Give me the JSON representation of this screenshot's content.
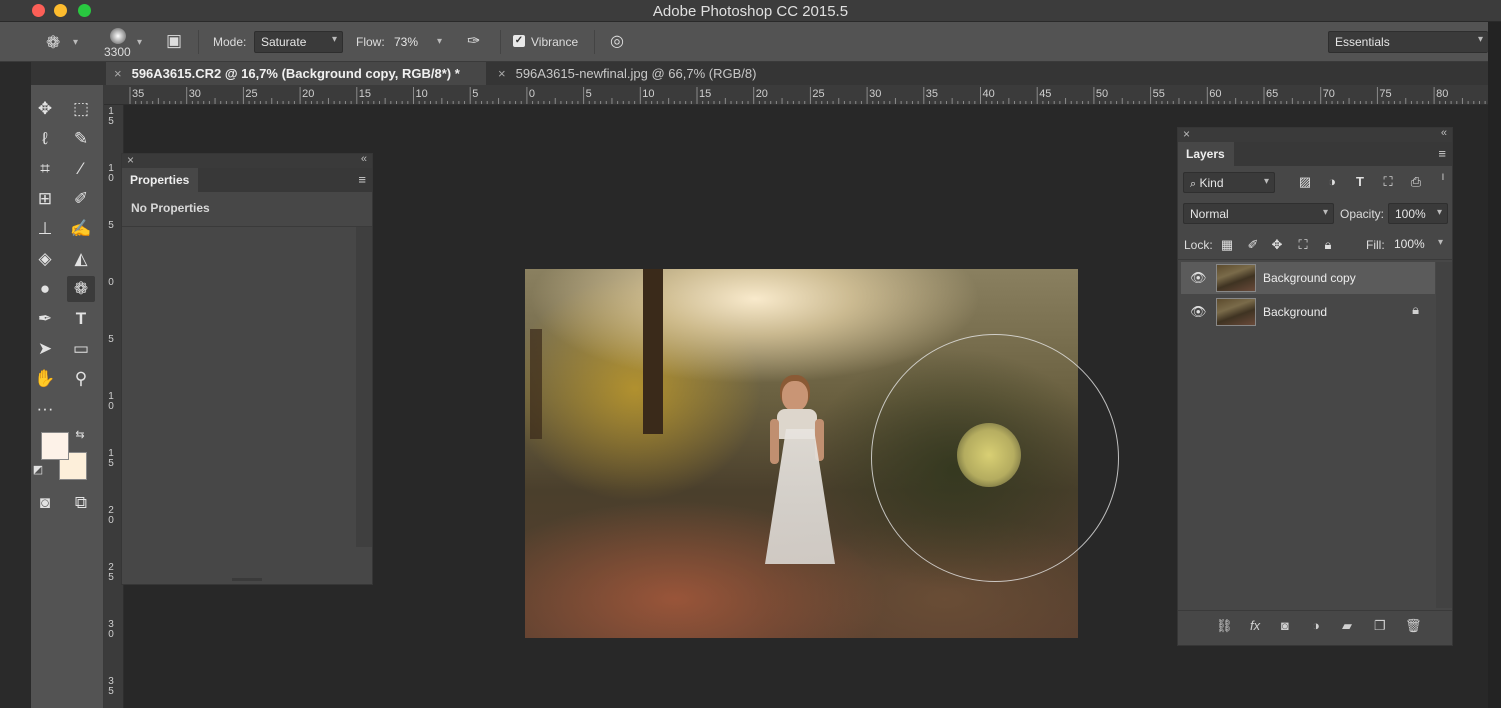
{
  "window": {
    "title": "Adobe Photoshop CC 2015.5"
  },
  "options_bar": {
    "brush_size": "3300",
    "mode_label": "Mode:",
    "mode_value": "Saturate",
    "flow_label": "Flow:",
    "flow_value": "73%",
    "vibrance_label": "Vibrance",
    "vibrance_checked": true,
    "workspace": "Essentials"
  },
  "tabs": [
    {
      "label": "596A3615.CR2 @ 16,7% (Background copy, RGB/8*) *",
      "active": true
    },
    {
      "label": "596A3615-newfinal.jpg @ 66,7% (RGB/8)",
      "active": false
    }
  ],
  "ruler": {
    "horizontal": [
      "35",
      "30",
      "25",
      "20",
      "15",
      "10",
      "5",
      "0",
      "5",
      "10",
      "15",
      "20",
      "25",
      "30",
      "35",
      "40",
      "45",
      "50",
      "55",
      "60",
      "65",
      "70",
      "75",
      "80"
    ],
    "vertical": [
      "15",
      "10",
      "5",
      "0",
      "5",
      "10",
      "15",
      "20",
      "25",
      "30",
      "35"
    ]
  },
  "properties_panel": {
    "title": "Properties",
    "message": "No Properties"
  },
  "layers_panel": {
    "title": "Layers",
    "filter_kind": "Kind",
    "blend_mode": "Normal",
    "opacity_label": "Opacity:",
    "opacity_value": "100%",
    "lock_label": "Lock:",
    "fill_label": "Fill:",
    "fill_value": "100%",
    "layers": [
      {
        "name": "Background copy",
        "selected": true,
        "locked": false
      },
      {
        "name": "Background",
        "selected": false,
        "locked": true
      }
    ]
  },
  "colors": {
    "foreground": "#fdf2e8",
    "background": "#fdefda"
  },
  "icons": {
    "tools": [
      "move-icon",
      "marquee-icon",
      "lasso-icon",
      "quick-select-icon",
      "crop-icon",
      "eyedropper-icon",
      "patch-icon",
      "brush-icon",
      "stamp-icon",
      "history-brush-icon",
      "eraser-icon",
      "paint-bucket-icon",
      "blur-icon",
      "sponge-icon",
      "pen-icon",
      "type-icon",
      "path-select-icon",
      "rectangle-icon",
      "hand-icon",
      "zoom-icon",
      "more-tools-icon"
    ]
  }
}
